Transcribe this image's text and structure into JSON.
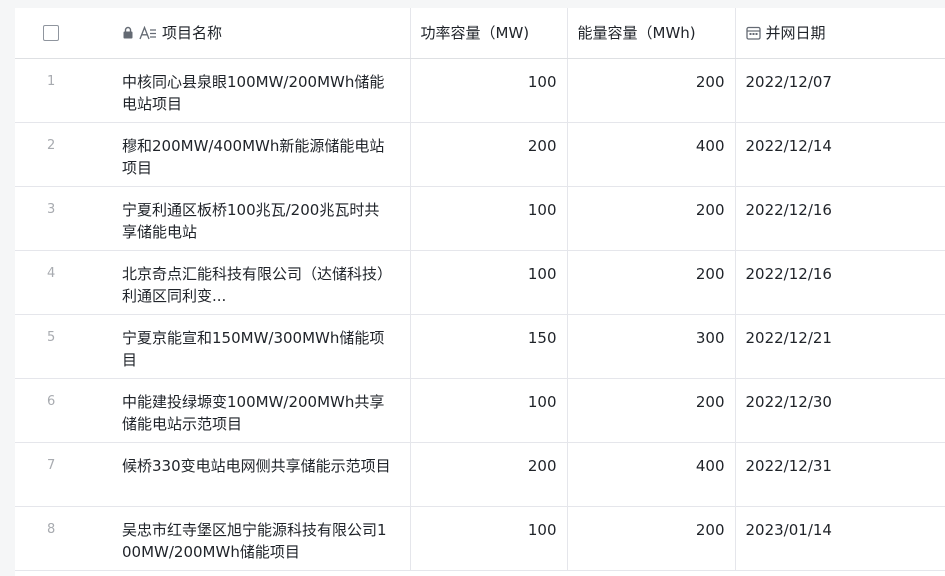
{
  "columns": {
    "name": "项目名称",
    "power": "功率容量（MW)",
    "energy": "能量容量（MWh)",
    "date": "并网日期"
  },
  "icons": {
    "lock": "lock-icon",
    "text_type": "text-type-icon",
    "date": "date-icon",
    "checkbox": "checkbox-icon"
  },
  "rows": [
    {
      "index": "1",
      "name": "中核同心县泉眼100MW/200MWh储能电站项目",
      "power": "100",
      "energy": "200",
      "date": "2022/12/07"
    },
    {
      "index": "2",
      "name": "穆和200MW/400MWh新能源储能电站项目",
      "power": "200",
      "energy": "400",
      "date": "2022/12/14"
    },
    {
      "index": "3",
      "name": "宁夏利通区板桥100兆瓦/200兆瓦时共享储能电站",
      "power": "100",
      "energy": "200",
      "date": "2022/12/16"
    },
    {
      "index": "4",
      "name": "北京奇点汇能科技有限公司（达储科技）利通区同利变...",
      "power": "100",
      "energy": "200",
      "date": "2022/12/16"
    },
    {
      "index": "5",
      "name": "宁夏京能宣和150MW/300MWh储能项目",
      "power": "150",
      "energy": "300",
      "date": "2022/12/21"
    },
    {
      "index": "6",
      "name": "中能建投绿塬变100MW/200MWh共享储能电站示范项目",
      "power": "100",
      "energy": "200",
      "date": "2022/12/30"
    },
    {
      "index": "7",
      "name": "候桥330变电站电网侧共享储能示范项目",
      "power": "200",
      "energy": "400",
      "date": "2022/12/31"
    },
    {
      "index": "8",
      "name": "吴忠市红寺堡区旭宁能源科技有限公司100MW/200MWh储能项目",
      "power": "100",
      "energy": "200",
      "date": "2023/01/14"
    }
  ]
}
